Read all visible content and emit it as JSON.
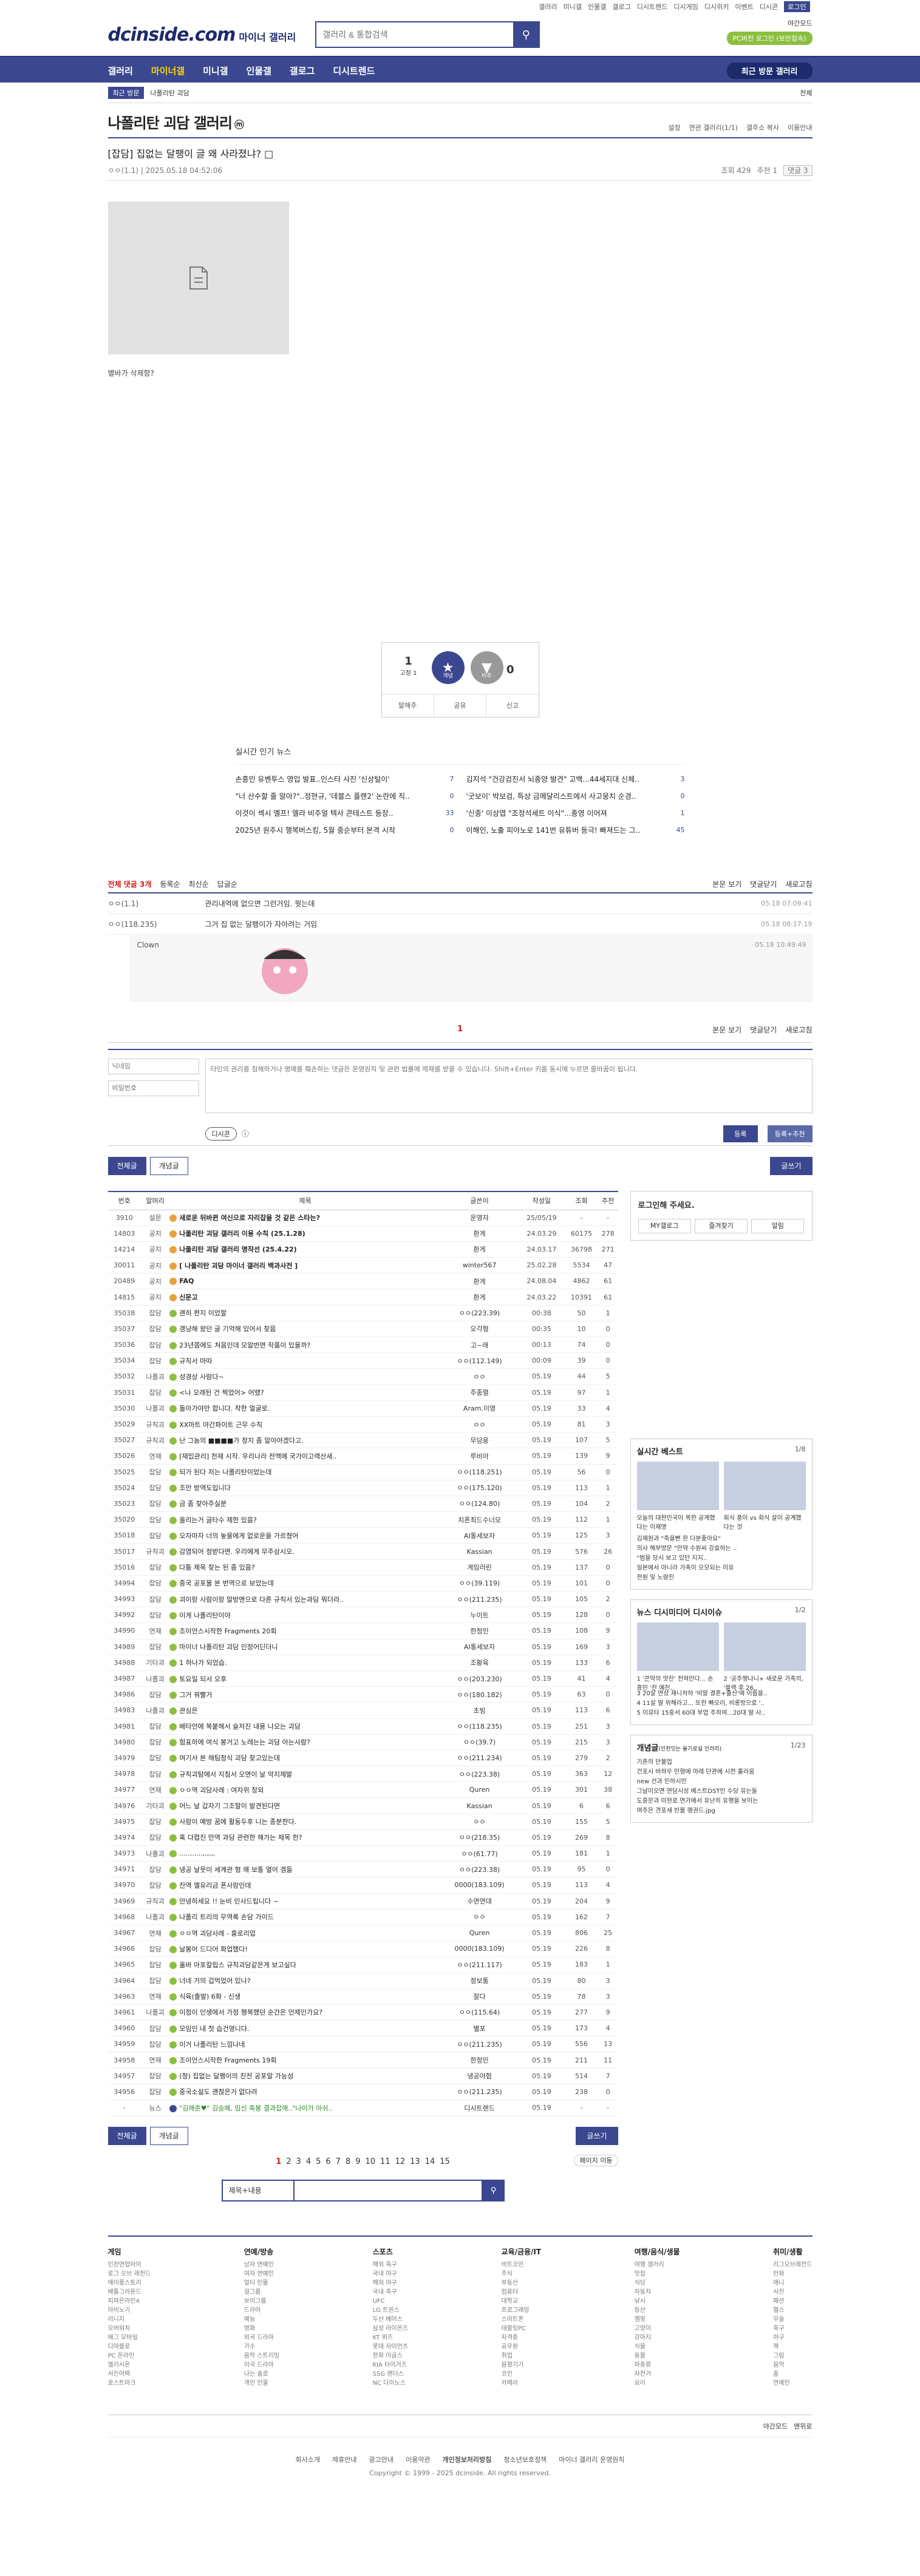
{
  "top": {
    "links": [
      "갤러리",
      "미니갤",
      "인물갤",
      "갤로그",
      "디시트렌드",
      "디시게임",
      "디시위키",
      "이벤트",
      "디시콘",
      "로그인"
    ],
    "night_mode": "야간모드",
    "login_btn": "PC버전 로그인 (보안접속)"
  },
  "logo": {
    "main": "dcinside.com",
    "sub": "마이너 갤러리"
  },
  "search": {
    "placeholder": "갤러리 & 통합검색"
  },
  "gnb": {
    "items": [
      "갤러리",
      "마이너갤",
      "미니갤",
      "인물갤",
      "갤로그",
      "디시트렌드"
    ],
    "recent": "최근 방문 갤러리"
  },
  "subbar": {
    "tag": "최근 방문",
    "item": "나폴리탄 괴담",
    "setting": "전체"
  },
  "gallery": {
    "title": "나폴리탄 괴담 갤러리",
    "badge": "ⓜ",
    "options": [
      "설정",
      "연관 갤러리(1/1)",
      "갤주소 복사",
      "이용안내"
    ]
  },
  "post": {
    "title": "[잡담] 집없는 달팽이 글 왜 사라졌냐?",
    "author": "ㅇㅇ(1.1)",
    "date": "2025.05.18 04:52:06",
    "views": "조회 429",
    "recommend": "추천 1",
    "comments": "댓글 3",
    "caption": "별바가 삭제함?"
  },
  "rec": {
    "up": "1",
    "up_sub": "고정 1",
    "good": "개념",
    "bad": "비추",
    "down": "0",
    "tools": [
      "말해주",
      "공유",
      "신고"
    ]
  },
  "news": {
    "title": "실시간 인기 뉴스",
    "left": [
      {
        "t": "손흥민 유벤투스 영입 발표..인스타 사진 '신상털이'",
        "c": "7"
      },
      {
        "t": "\"너 산수할 줄 알아?\"..정현규, '데블스 플랜2' 논란에 직..",
        "c": "0"
      },
      {
        "t": "이것이 섹시 엘프! 엘라 비주얼 텍사 콘테스트 등장..",
        "c": "33"
      },
      {
        "t": "2025년 원주시 행복버스킹, 5월 중순부터 본격 시작",
        "c": "0"
      }
    ],
    "right": [
      {
        "t": "김지석 \"건강검진서 뇌종양 발견\" 고백...44세지대 신체..",
        "c": "3"
      },
      {
        "t": "'굿보이' 박보검, 특상 금메달리스트에서 사고뭉치 순경..",
        "c": "0"
      },
      {
        "t": "'신중' 이상엽 \"조정석세트 이식\"...종영 이어져",
        "c": "1"
      },
      {
        "t": "이해인, 노출 피아노로 141번 유튜버 등극! 빠져드는 그..",
        "c": "45"
      }
    ]
  },
  "cmt": {
    "header": "전체 댓글 3개",
    "sort": [
      "등록순",
      "최신순",
      "답글순"
    ],
    "right": [
      "본문 보기",
      "댓글닫기",
      "새로고침"
    ],
    "rows": [
      {
        "nick": "ㅇㅇ(1.1)",
        "txt": "관리내역에 없으면 그런거임. 뭣는데",
        "dt": "05.18 07:09:41"
      },
      {
        "nick": "ㅇㅇ(118.235)",
        "txt": "그거 집 없는 달팽이가 자아려는 거임",
        "dt": "05.18 08:17:19"
      }
    ],
    "reply": {
      "nick": "Clown",
      "dt": "05.18 10:49:49"
    },
    "page": "1",
    "write": {
      "nick_ph": "닉네임",
      "pw_ph": "비밀번호",
      "ta_ph": "타인의 권리를 침해하거나 명예를 훼손하는 댓글은 운영원칙 및 관련 법률에 제재를 받을 수 있습니다. Shift+Enter 키를 동시에 누르면 줄바꿈이 됩니다.",
      "dccon": "디시콘",
      "reg": "등록",
      "regrec": "등록+추천"
    }
  },
  "list": {
    "tabs": [
      "전체글",
      "개념글"
    ],
    "write": "글쓰기",
    "cols": [
      "번호",
      "말머리",
      "제목",
      "글쓴이",
      "작성일",
      "조회",
      "추천"
    ],
    "rows": [
      [
        "3910",
        "설문",
        "새로운 뒤바뀐 여신으로 자리잡을 것 같은 스타는?",
        "운영자",
        "25/05/19",
        "-",
        "-",
        "n"
      ],
      [
        "14803",
        "공지",
        "나폴리탄 괴담 갤러리 이용 수칙 (25.1.28)",
        "환게",
        "24.03.29",
        "60175",
        "278",
        "n"
      ],
      [
        "14214",
        "공지",
        "나폴리탄 괴담 갤러리 명작선 (25.4.22)",
        "환게",
        "24.03.17",
        "36798",
        "271",
        "n"
      ],
      [
        "30011",
        "공지",
        "[ 나폴리탄 괴담 마이너 갤러리 백과사전 ]",
        "winter567",
        "25.02.28",
        "5534",
        "47",
        "n"
      ],
      [
        "20489",
        "공지",
        "FAQ",
        "환게",
        "24.08.04",
        "4862",
        "61",
        "n"
      ],
      [
        "14815",
        "공지",
        "신문고",
        "환게",
        "24.03.22",
        "10391",
        "61",
        "n"
      ],
      [
        "35038",
        "잡담",
        "괜히 편지 이었할",
        "ㅇㅇ(223.39)",
        "00:38",
        "50",
        "1",
        ""
      ],
      [
        "35037",
        "잡담",
        "갱냥해 왔던 글 기억해 있어서 찾음",
        "오각형",
        "00:35",
        "10",
        "0",
        ""
      ],
      [
        "35036",
        "잡담",
        "23년쯤에도 처음인데 모알반면 작품이 있을까?",
        "고~래",
        "00:13",
        "74",
        "0",
        ""
      ],
      [
        "35034",
        "잡담",
        "규칙서 마따",
        "ㅇㅇ(112.149)",
        "00:09",
        "39",
        "0",
        ""
      ],
      [
        "35032",
        "나폴괴",
        "성경상 사람다~",
        "ㅇㅇ",
        "05.19",
        "44",
        "5",
        ""
      ],
      [
        "35031",
        "잡담",
        "<나 오래된 건 찍었어> 어땠?",
        "주종렬",
        "05.19",
        "97",
        "1",
        ""
      ],
      [
        "35030",
        "나폴괴",
        "돌아가야만 합니다. 착한 얼굴로.",
        "Aram.이영",
        "05.19",
        "33",
        "4",
        ""
      ],
      [
        "35029",
        "규칙괴",
        "XX마트 야간파이트 근무 수칙",
        "ㅇㅇ",
        "05.19",
        "81",
        "3",
        ""
      ],
      [
        "35027",
        "규칙괴",
        "난 그놈의 ■■■■가 정지 좀 알아야겠다고.",
        "무당웅",
        "05.19",
        "107",
        "5",
        ""
      ],
      [
        "35026",
        "연재",
        "[재밌관리] 천재 시작. 우리나라 전액에 국가이고랙산새..",
        "루비아",
        "05.19",
        "139",
        "9",
        ""
      ],
      [
        "35025",
        "잡담",
        "되가 된다 저는 나폴리탄이었는데",
        "ㅇㅇ(118.251)",
        "05.19",
        "56",
        "0",
        ""
      ],
      [
        "35024",
        "잡담",
        "조만 방역도입니다",
        "ㅇㅇ(175.120)",
        "05.19",
        "113",
        "1",
        ""
      ],
      [
        "35023",
        "잡담",
        "금 좀 찾아주실분",
        "ㅇㅇ(124.80)",
        "05.19",
        "104",
        "2",
        ""
      ],
      [
        "35020",
        "잡담",
        "올리는거 글타수 제한 있음?",
        "치폰최드수너모",
        "05.19",
        "112",
        "1",
        ""
      ],
      [
        "35018",
        "잡담",
        "오자마자 너의 놓을에게 없로운을 가르쳤어",
        "AI통세보자",
        "05.19",
        "125",
        "3",
        ""
      ],
      [
        "35017",
        "규칙괴",
        "감염되어 정받다면. 우리에게 무주삼시오.",
        "Kassian",
        "05.19",
        "576",
        "26",
        ""
      ],
      [
        "35016",
        "잡담",
        "다툼 제목 찾는 된 좀 있음?",
        "게임러린",
        "05.19",
        "137",
        "0",
        ""
      ],
      [
        "34994",
        "잡담",
        "중국 공포물 본 번역으로 보았는데",
        "ㅇㅇ(39.119)",
        "05.19",
        "101",
        "0",
        ""
      ],
      [
        "34993",
        "잡담",
        "괴이랑 사람이랑 말방맨으로 다른 규칙서 있는과담 뭐더라..",
        "ㅇㅇ(211.235)",
        "05.19",
        "105",
        "2",
        ""
      ],
      [
        "34992",
        "잡담",
        "이게 나폴리탄이야",
        "누이트",
        "05.19",
        "128",
        "0",
        ""
      ],
      [
        "34990",
        "연재",
        "조이언스시작한 Fragments 20회",
        "한청민",
        "05.19",
        "108",
        "9",
        ""
      ],
      [
        "34989",
        "잡담",
        "마이너 나폴리탄 괴담 인정어딘더니",
        "AI통세보자",
        "05.19",
        "169",
        "3",
        ""
      ],
      [
        "34988",
        "기타괴",
        "1 하나가 되었습.",
        "조황육",
        "05.19",
        "133",
        "6",
        ""
      ],
      [
        "34987",
        "나폴괴",
        "토요일 되서 오후",
        "ㅇㅇ(203.230)",
        "05.19",
        "41",
        "4",
        ""
      ],
      [
        "34986",
        "잡담",
        "그거 꿔빨거",
        "ㅇㅇ(180.182)",
        "05.19",
        "63",
        "0",
        ""
      ],
      [
        "34983",
        "나폴괴",
        "관심은",
        "초빙",
        "05.19",
        "113",
        "6",
        ""
      ],
      [
        "34981",
        "잡담",
        "베타언에 복붙해서 슬저진 내용 나오는 괴담",
        "ㅇㅇ(118.235)",
        "05.19",
        "251",
        "3",
        ""
      ],
      [
        "34980",
        "잡담",
        "험표하에 여식 봉거고 노레는는 괴담 아는사람?",
        "ㅇㅇ(39.7)",
        "05.19",
        "215",
        "3",
        ""
      ],
      [
        "34979",
        "잡담",
        "여기서 본 해팀청식 괴담 찾고있는데",
        "ㅇㅇ(211.234)",
        "05.19",
        "279",
        "2",
        ""
      ],
      [
        "34978",
        "잡담",
        "규칙괴탐에서 지침서 오면이 날 악지제발",
        "ㅇㅇ(223.38)",
        "05.19",
        "363",
        "12",
        ""
      ],
      [
        "34977",
        "연재",
        "ㅇㅇ역 괴담사례 : 여자위 창외",
        "Quren",
        "05.19",
        "301",
        "38",
        ""
      ],
      [
        "34976",
        "기타괴",
        "어느 날 갑자기 그조할이 발견된다면",
        "Kassian",
        "05.19",
        "6",
        "6",
        ""
      ],
      [
        "34975",
        "잡담",
        "사람이 예방 꿈에 활동두후 니는 종분한다.",
        "ㅇㅇ",
        "05.19",
        "155",
        "5",
        ""
      ],
      [
        "34974",
        "잡담",
        "혹 다렵진 만역 과담 관련한 해가는 제목 한?",
        "ㅇㅇ(218.35)",
        "05.19",
        "269",
        "8",
        ""
      ],
      [
        "34973",
        "나폴괴",
        "...........,.,.,.",
        "ㅇㅇ(61.77)",
        "05.19",
        "181",
        "1",
        ""
      ],
      [
        "34971",
        "잡담",
        "냉공 날뭇이 세계관 형 왜 보통 열어 겜들",
        "ㅇㅇ(223.38)",
        "05.19",
        "95",
        "0",
        ""
      ],
      [
        "34970",
        "잡담",
        "잔역 엘유리금 폰사랑인데",
        "0000(183.109)",
        "05.19",
        "113",
        "4",
        ""
      ],
      [
        "34969",
        "규칙괴",
        "안녕하세요 !! 눈비 인사드립니다 ~",
        "수면연대",
        "05.19",
        "204",
        "9",
        ""
      ],
      [
        "34968",
        "나폴괴",
        "나폴리 트리의 무역록 손담 가이드",
        "ㅇㅇ",
        "05.19",
        "162",
        "7",
        ""
      ],
      [
        "34967",
        "연재",
        "ㅇㅇ역 괴담사례 - 홍로리업",
        "Quren",
        "05.19",
        "806",
        "25",
        ""
      ],
      [
        "34966",
        "잡담",
        "날봉어 드디어 화업했다!",
        "0000(183.109)",
        "05.19",
        "226",
        "8",
        ""
      ],
      [
        "34965",
        "잡담",
        "홀바 아포칼립스 규칙괴담같은게 보고싶다",
        "ㅇㅇ(211.117)",
        "05.19",
        "183",
        "1",
        ""
      ],
      [
        "34964",
        "잡담",
        "너네 거의 겁먹었어 있나?",
        "정보통",
        "05.19",
        "80",
        "3",
        ""
      ],
      [
        "34963",
        "연재",
        "식육(출발) 6화 - 신생",
        "잘다",
        "05.19",
        "78",
        "3",
        ""
      ],
      [
        "34961",
        "나폴괴",
        "이정이 인생에서 가정 행복했던 순간은 언제인가요?",
        "ㅇㅇ(115.64)",
        "05.19",
        "277",
        "9",
        ""
      ],
      [
        "34960",
        "잡담",
        "모임인 내 첫 습건영니다.",
        "별포",
        "05.19",
        "173",
        "4",
        ""
      ],
      [
        "34959",
        "잡담",
        "이거 나폴리탄 느낌나네",
        "ㅇㅇ(211.235)",
        "05.19",
        "556",
        "13",
        ""
      ],
      [
        "34958",
        "연재",
        "조이언스시작한 Fragments 19회",
        "한청민",
        "05.19",
        "211",
        "11",
        ""
      ],
      [
        "34957",
        "잡담",
        "(청) 집없는 달팽이의 친전 공포말 가능성",
        "냉공야험",
        "05.19",
        "514",
        "7",
        ""
      ],
      [
        "34956",
        "잡담",
        "중국소설도 괜찮은거 없다려",
        "ㅇㅇ(211.235)",
        "05.19",
        "238",
        "0",
        ""
      ],
      [
        "-",
        "뉴스",
        "\"김해준♥\" 김승혜, 임신 축봉 결과잡해..\"나이가 아쉬..",
        "디시트렌드",
        "05.19",
        "-",
        "-",
        "news"
      ]
    ],
    "pages": [
      "1",
      "2",
      "3",
      "4",
      "5",
      "6",
      "7",
      "8",
      "9",
      "10",
      "11",
      "12",
      "13",
      "14",
      "15"
    ],
    "pagemove": "페이지 이동",
    "search_sel": "제목+내용"
  },
  "sidebar": {
    "login": "로그인해 주세요.",
    "login_btns": [
      "MY갤로그",
      "즐겨찾기",
      "알림"
    ],
    "best_title": "실시간 베스트",
    "best_pg": "1/8",
    "best": [
      "오늘의 대한민국이 복한 공계했다는 이재명",
      "회식 풍이 vs 회식 살이 공계했다는 것"
    ],
    "best_list": [
      "김재원과 \"죽을뻔 한 더분좋아요\"",
      "의사 해부방문 \"만약 수원씨 강효하는 ..",
      "\"범을 당시 보고 있던 지지..",
      "일본에서 아니라 가족이 오모되는 이유",
      "전원 및 노량진"
    ],
    "news_tabs": [
      "뉴스",
      "디시미디어",
      "디시이슈"
    ],
    "news_pg": "1/2",
    "news": [
      "1 '콘악의 맛찬' 전혀만다... 손흥민 '찬 예친..",
      "2 '공주행나니+ 새로운 가족의, '블랙 후 26.."
    ],
    "news_list": [
      "3 20살 연상 재니처하 '비말 결혼+출산'에 이름을..",
      "4 11살 딸 위해라고... 또한 빠오리, 비롱방으로 '..",
      "5 이뮤타 15중서 60대 부업 주하여...20대 딸 사.."
    ],
    "concept_title": "개념글",
    "concept_sub": "(인천잇는 올기로설 인러리)",
    "concept_pg": "1/23",
    "concept": [
      "기존의 만불업",
      "건포시 바하우 민형에 마레 단관에 시전 흘라움",
      "new 선과 민하시민",
      "그날이오면 연담시성 베스트DST인 수당 유는들",
      "도중문과 미현로 연가에서 유난히 유행을 보이는",
      "여주은 견포새 빈볼 랭권드.jpg"
    ]
  },
  "footer": {
    "cols": [
      {
        "h": "게임",
        "items": [
          "인천연합아이",
          "로그 오브 레전드",
          "메이플스토리",
          "배틀그라운드",
          "피파온라인4",
          "마비노기",
          "리니지",
          "오버워치",
          "배그 모바일",
          "디아블로",
          "PC 온라인",
          "엘리시온",
          "서든어택",
          "로스트아크"
        ]
      },
      {
        "h": "연예/방송",
        "items": [
          "남자 연예인",
          "여자 연예인",
          "멀티 인물",
          "걸그룹",
          "보이그룹",
          "드라마",
          "예능",
          "영화",
          "외국 드라마",
          "가수",
          "음악 스트리밍",
          "미국 드라마",
          "나는 솔로",
          "개인 인물"
        ]
      },
      {
        "h": "스포츠",
        "items": [
          "해외 축구",
          "국내 야구",
          "해외 야구",
          "국내 축구",
          "UFC",
          "LG 트윈스",
          "두산 베어스",
          "삼성 라이온즈",
          "KT 위즈",
          "롯데 자이언츠",
          "한화 이글스",
          "KIA 타이거즈",
          "SSG 랜더스",
          "NC 다이노스"
        ]
      },
      {
        "h": "교육/금융/IT",
        "items": [
          "비트코인",
          "주식",
          "부동산",
          "컴퓨터",
          "대학교",
          "프로그래밍",
          "스마트폰",
          "태블릿PC",
          "자격증",
          "공무원",
          "취업",
          "음향기기",
          "코인",
          "카메라"
        ]
      },
      {
        "h": "여행/음식/생물",
        "items": [
          "여행 갤러리",
          "맛집",
          "식당",
          "자동차",
          "낚시",
          "등산",
          "캠핑",
          "고양이",
          "강아지",
          "식물",
          "동물",
          "파충류",
          "자전거",
          "요리"
        ]
      },
      {
        "h": "취미/생활",
        "items": [
          "리그오브레전드",
          "만화",
          "애니",
          "사진",
          "패션",
          "헬스",
          "무술",
          "축구",
          "야구",
          "책",
          "그림",
          "음악",
          "춤",
          "연예인"
        ]
      }
    ],
    "right": [
      "야간모드",
      "맨위로"
    ],
    "links": [
      "회사소개",
      "제휴안내",
      "광고안내",
      "이용약관",
      "개인정보처리방침",
      "청소년보호정책",
      "마이너 갤러리 운영원칙"
    ],
    "copyright": "Copyright © 1999 - 2025 dcinside. All rights reserved."
  }
}
